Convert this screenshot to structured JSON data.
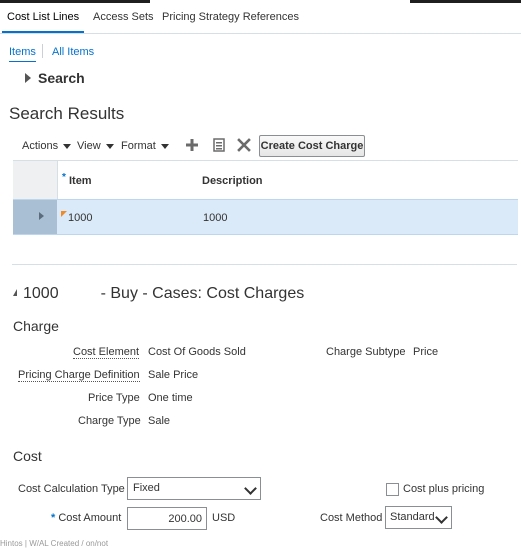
{
  "tabs": [
    {
      "label": "Cost List Lines",
      "active": true
    },
    {
      "label": "Access Sets",
      "active": false
    },
    {
      "label": "Pricing Strategy References",
      "active": false
    }
  ],
  "subtabs": [
    {
      "label": "Items",
      "active": true
    },
    {
      "label": "All Items",
      "active": false
    }
  ],
  "search": {
    "header": "Search"
  },
  "results": {
    "title": "Search Results",
    "toolbar": {
      "actions_label": "Actions",
      "view_label": "View",
      "format_label": "Format",
      "add_icon": "plus-icon",
      "detach_icon": "clipboard-icon",
      "delete_icon": "x-icon",
      "create_button": "Create Cost Charge"
    },
    "columns": {
      "item": "Item",
      "description": "Description",
      "item_required_marker": "*"
    },
    "rows": [
      {
        "item": "1000",
        "description": "1000"
      }
    ]
  },
  "detail": {
    "item_number": "1000",
    "title_suffix": "- Buy - Cases: Cost Charges",
    "charge_section": "Charge",
    "cost_element_label": "Cost Element",
    "cost_element_value": "Cost Of Goods Sold",
    "charge_subtype_label": "Charge Subtype",
    "charge_subtype_value": "Price",
    "pricing_charge_definition_label": "Pricing Charge Definition",
    "pricing_charge_definition_value": "Sale Price",
    "price_type_label": "Price Type",
    "price_type_value": "One time",
    "charge_type_label": "Charge Type",
    "charge_type_value": "Sale",
    "cost_section": "Cost",
    "cost_calc_type_label": "Cost Calculation Type",
    "cost_calc_type_value": "Fixed",
    "cost_plus_pricing_label": "Cost plus pricing",
    "cost_amount_required_marker": "*",
    "cost_amount_label": "Cost Amount",
    "cost_amount_value": "200.00",
    "currency": "USD",
    "cost_method_label": "Cost Method",
    "cost_method_value": "Standard"
  },
  "footer": {
    "text": "Hintos | W/AL Created / on/not"
  },
  "colors": {
    "accent": "#0572ce",
    "selected_row": "#dbeaf8",
    "flag": "#f08a24"
  }
}
